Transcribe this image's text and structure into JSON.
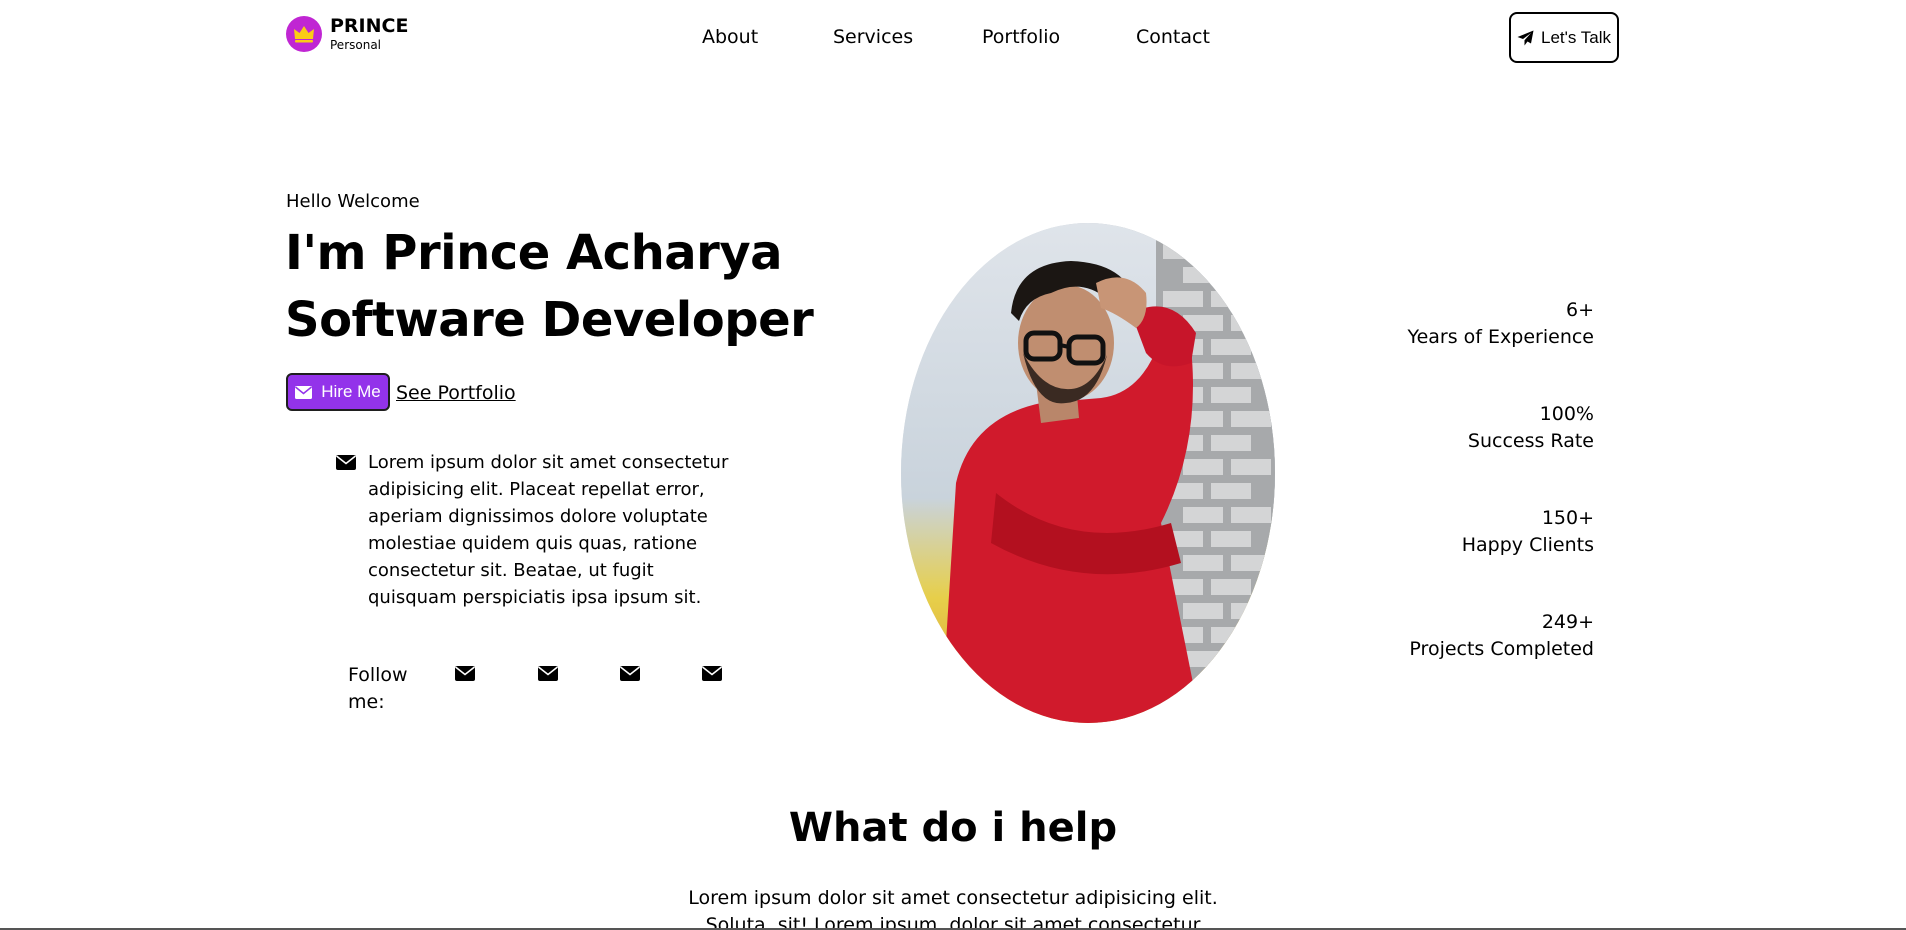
{
  "brand": {
    "name": "PRINCE",
    "tagline": "Personal",
    "accent": "#c026d3"
  },
  "nav": {
    "items": [
      "About",
      "Services",
      "Portfolio",
      "Contact"
    ]
  },
  "header": {
    "cta_label": "Let's Talk"
  },
  "hero": {
    "greeting": "Hello Welcome",
    "name_line": "I'm Prince Acharya",
    "role_line": "Software Developer",
    "hire_label": "Hire Me",
    "portfolio_link": "See Portfolio",
    "description": "Lorem ipsum dolor sit amet consectetur adipisicing elit. Placeat repellat error, aperiam dignissimos dolore voluptate molestiae quidem quis quas, ratione consectetur sit. Beatae, ut fugit quisquam perspiciatis ipsa ipsum sit.",
    "follow_label": "Follow me:",
    "social_icons": [
      "envelope-icon",
      "envelope-icon",
      "envelope-icon",
      "envelope-icon"
    ]
  },
  "stats": [
    {
      "value": "6+",
      "label": "Years of Experience"
    },
    {
      "value": "100%",
      "label": "Success Rate"
    },
    {
      "value": "150+",
      "label": "Happy Clients"
    },
    {
      "value": "249+",
      "label": "Projects Completed"
    }
  ],
  "help_section": {
    "title": "What do i help",
    "text": "Lorem ipsum dolor sit amet consectetur adipisicing elit. Soluta, sit! Lorem ipsum, dolor sit amet consectetur adipisicing elit."
  },
  "colors": {
    "hire_button": "#9333ea",
    "logo_badge": "#c026d3",
    "crown": "#facc15"
  }
}
